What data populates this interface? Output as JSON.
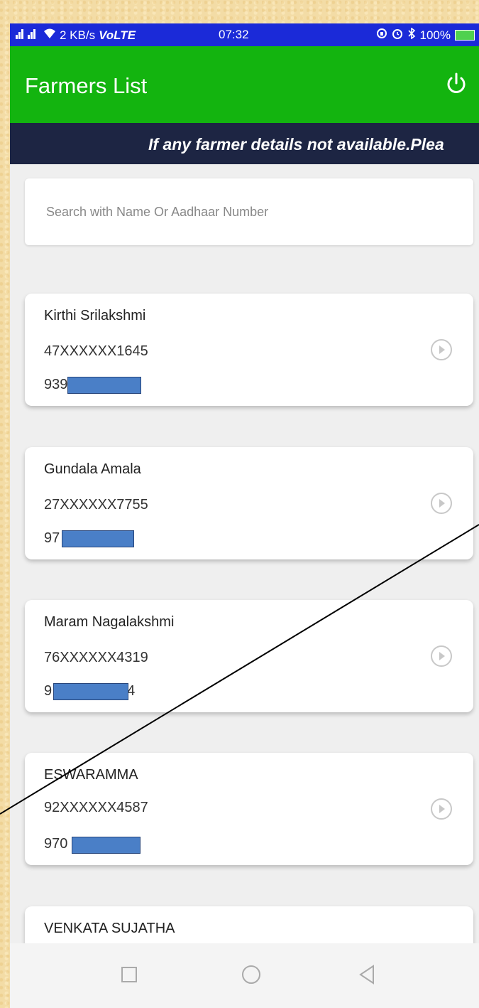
{
  "statusbar": {
    "signal": "📶",
    "speed": "2 KB/s",
    "volte": "VoLTE",
    "time": "07:32",
    "battery": "100%"
  },
  "appbar": {
    "title": "Farmers List",
    "power_icon": "power-icon"
  },
  "banner": {
    "text": "If any farmer details not available.Plea"
  },
  "search": {
    "placeholder": "Search with Name Or Aadhaar Number",
    "value": ""
  },
  "farmers": [
    {
      "name": "Kirthi Srilakshmi",
      "aadhaar": "47XXXXXX1645",
      "phone_prefix": "939"
    },
    {
      "name": "Gundala Amala",
      "aadhaar": "27XXXXXX7755",
      "phone_prefix": "97"
    },
    {
      "name": "Maram Nagalakshmi",
      "aadhaar": "76XXXXXX4319",
      "phone_prefix": "9",
      "phone_suffix": "4"
    },
    {
      "name": "ESWARAMMA",
      "aadhaar": "92XXXXXX4587",
      "phone_prefix": "970"
    },
    {
      "name": "VENKATA SUJATHA"
    }
  ],
  "colors": {
    "appbar": "#13b40f",
    "banner": "#1d2543",
    "statusbar": "#1b2ad8",
    "mask": "#4a7fc7"
  }
}
